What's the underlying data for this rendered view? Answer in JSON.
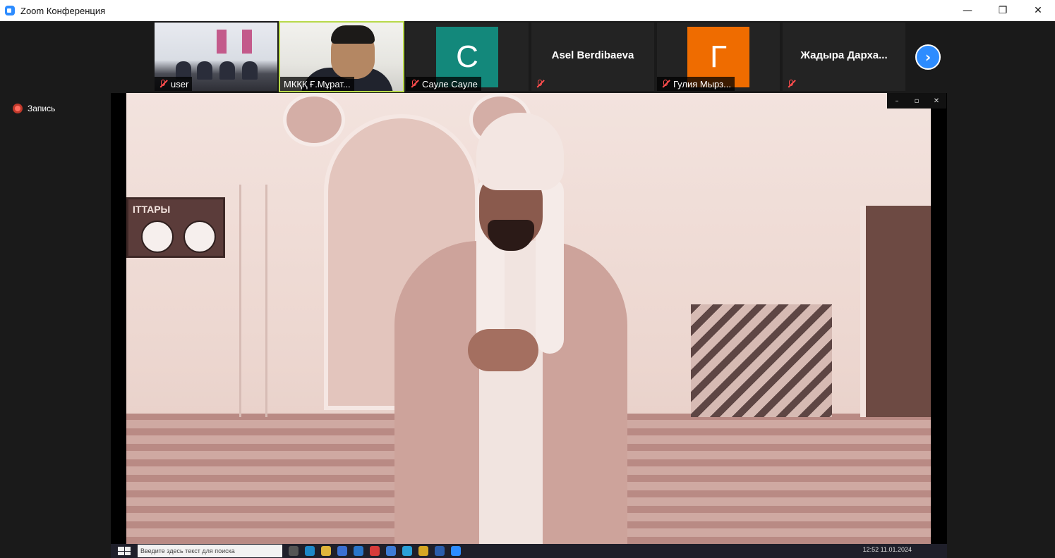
{
  "window": {
    "title": "Zoom Конференция",
    "controls": {
      "minimize": "—",
      "maximize": "❐",
      "close": "✕"
    }
  },
  "participants": [
    {
      "name": "user",
      "muted": true,
      "type": "video-room"
    },
    {
      "name": "МКҚҚ Ғ.Мұрат...",
      "muted": false,
      "type": "video-man",
      "active": true
    },
    {
      "name": "Сауле Сауле",
      "muted": true,
      "type": "avatar",
      "initial": "С",
      "color": "#13887b"
    },
    {
      "name": "Asel Berdibaeva",
      "muted": true,
      "type": "text"
    },
    {
      "name": "Гулия Мырз...",
      "muted": true,
      "type": "avatar",
      "initial": "Г",
      "color": "#ef6c00"
    },
    {
      "name": "Жадыра Дарха...",
      "muted": true,
      "type": "text"
    }
  ],
  "navigation": {
    "next_icon": "›"
  },
  "recording": {
    "label": "Запись"
  },
  "shared_screen": {
    "controls": {
      "minimize": "–",
      "restore": "▫",
      "close": "✕"
    },
    "board_text": "ІТТАРЫ",
    "taskbar": {
      "search_placeholder": "Введите здесь текст для поиска",
      "tray_time": "12:52",
      "tray_date": "11.01.2024"
    }
  }
}
